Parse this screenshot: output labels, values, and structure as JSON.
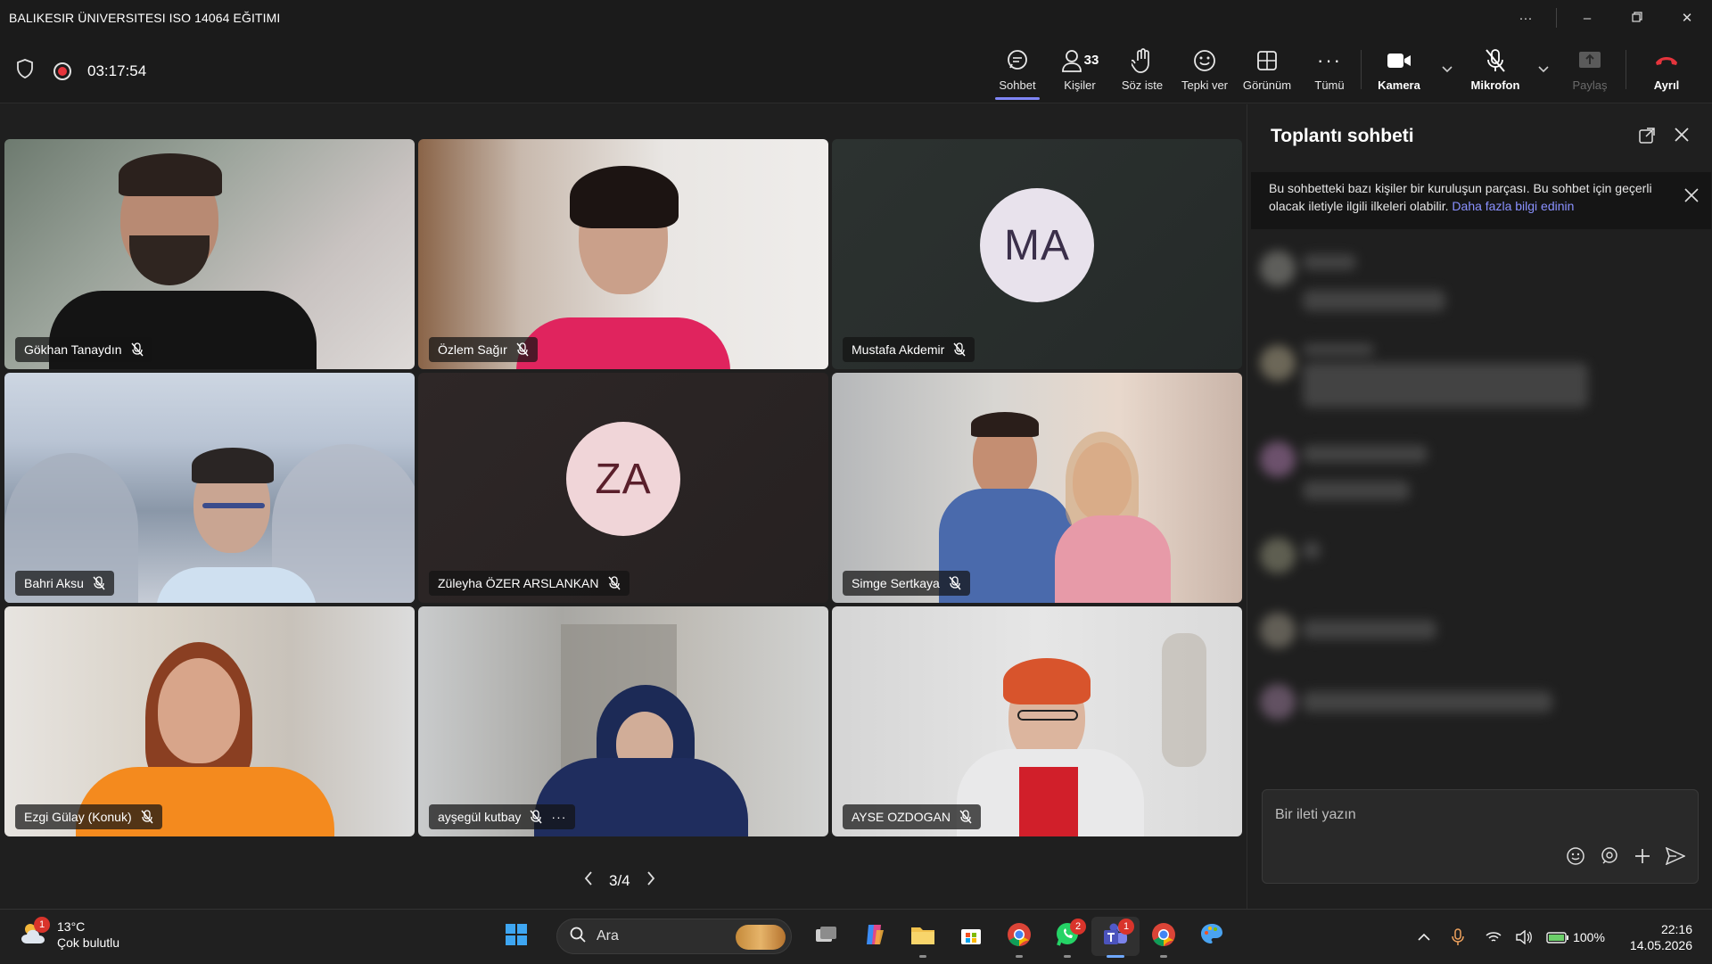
{
  "window": {
    "title": "BALIKESIR ÜNIVERSITESI ISO 14064 EĞITIMI"
  },
  "toolbar": {
    "timer": "03:17:54",
    "chat_label": "Sohbet",
    "people_label": "Kişiler",
    "people_count": "33",
    "raise_label": "Söz iste",
    "react_label": "Tepki ver",
    "view_label": "Görünüm",
    "more_label": "Tümü",
    "camera_label": "Kamera",
    "mic_label": "Mikrofon",
    "share_label": "Paylaş",
    "leave_label": "Ayrıl"
  },
  "participants": [
    {
      "name": "Gökhan Tanaydın"
    },
    {
      "name": "Özlem Sağır"
    },
    {
      "name": "Mustafa Akdemir",
      "initials": "MA"
    },
    {
      "name": "Bahri Aksu"
    },
    {
      "name": "Züleyha ÖZER ARSLANKAN",
      "initials": "ZA"
    },
    {
      "name": "Simge Sertkaya"
    },
    {
      "name": "Ezgi Gülay (Konuk)"
    },
    {
      "name": "ayşegül kutbay",
      "more": "···"
    },
    {
      "name": "AYSE OZDOGAN"
    }
  ],
  "pager": {
    "text": "3/4"
  },
  "chat": {
    "title": "Toplantı sohbeti",
    "notice_text": "Bu sohbetteki bazı kişiler bir kuruluşun parçası. Bu sohbet için geçerli olacak iletiyle ilgili ilkeleri olabilir.",
    "notice_link": "Daha fazla bilgi edinin",
    "compose_placeholder": "Bir ileti yazın"
  },
  "taskbar": {
    "weather_temp": "13°C",
    "weather_desc": "Çok bulutlu",
    "weather_badge": "1",
    "search_label": "Ara",
    "whatsapp_badge": "2",
    "teams_badge": "1",
    "battery": "100%",
    "time": "22:16",
    "date": "14.05.2026"
  },
  "colors": {
    "accent": "#7f85f5",
    "leave": "#e5343c",
    "link": "#8a91ff"
  }
}
